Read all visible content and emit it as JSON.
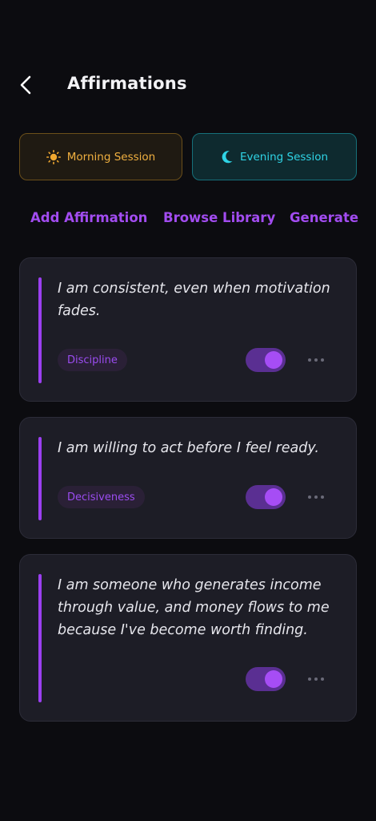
{
  "header": {
    "title": "Affirmations",
    "back_icon": "chevron-left-icon"
  },
  "sessions": {
    "morning": {
      "label": "Morning Session",
      "icon": "sun-icon",
      "color": "#f0b040"
    },
    "evening": {
      "label": "Evening Session",
      "icon": "moon-icon",
      "color": "#2fd4e6"
    }
  },
  "actions": {
    "add": "Add Affirmation",
    "browse": "Browse Library",
    "generate": "Generate"
  },
  "affirmations": [
    {
      "text": "I am consistent, even when motivation fades.",
      "tag": "Discipline",
      "enabled": true
    },
    {
      "text": "I am willing to act before I feel ready.",
      "tag": "Decisiveness",
      "enabled": true
    },
    {
      "text": "I am someone who generates income through value, and money flows to me because I've become worth finding.",
      "tag": "",
      "enabled": true
    }
  ],
  "colors": {
    "accent": "#9b3ff0",
    "background": "#0c0c10",
    "card": "#1d1d26"
  }
}
